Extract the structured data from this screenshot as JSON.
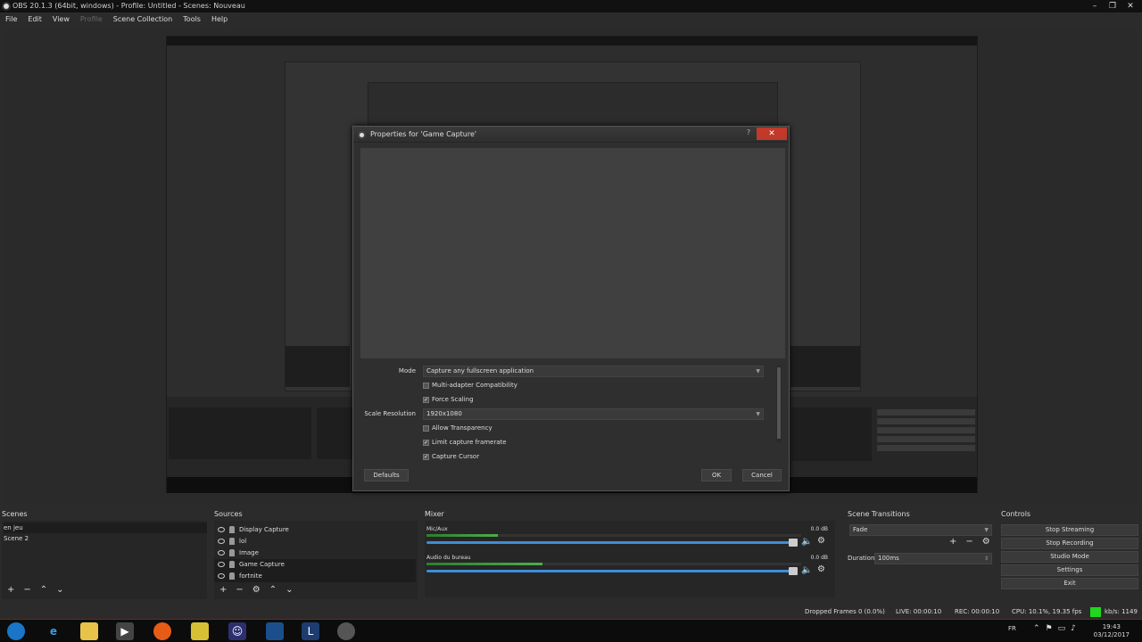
{
  "window": {
    "title": "OBS 20.1.3 (64bit, windows) - Profile: Untitled - Scenes: Nouveau",
    "controls": [
      "–",
      "❐",
      "✕"
    ]
  },
  "menu": [
    "File",
    "Edit",
    "View",
    "Profile",
    "Scene Collection",
    "Tools",
    "Help"
  ],
  "dialog": {
    "title": "Properties for 'Game Capture'",
    "help": "?",
    "close": "✕",
    "mode_label": "Mode",
    "mode_value": "Capture any fullscreen application",
    "multi_adapter": "Multi-adapter Compatibility",
    "force_scaling": "Force Scaling",
    "scale_label": "Scale Resolution",
    "scale_value": "1920x1080",
    "allow_transparency": "Allow Transparency",
    "limit_framerate": "Limit capture framerate",
    "capture_cursor": "Capture Cursor",
    "check_mark": "✓",
    "defaults": "Defaults",
    "ok": "OK",
    "cancel": "Cancel"
  },
  "scenes": {
    "title": "Scenes",
    "items": [
      "en jeu",
      "Scene 2"
    ]
  },
  "sources": {
    "title": "Sources",
    "items": [
      "Display Capture",
      "lol",
      "Image",
      "Game Capture",
      "fortnite"
    ]
  },
  "mixer": {
    "title": "Mixer",
    "tracks": [
      {
        "name": "Mic/Aux",
        "db": "0.0 dB",
        "level": 0.19
      },
      {
        "name": "Audio du bureau",
        "db": "0.0 dB",
        "level": 0.31
      }
    ]
  },
  "transitions": {
    "title": "Scene Transitions",
    "type": "Fade",
    "duration_label": "Duration",
    "duration_value": "100ms"
  },
  "controls": {
    "title": "Controls",
    "buttons": [
      "Stop Streaming",
      "Stop Recording",
      "Studio Mode",
      "Settings",
      "Exit"
    ]
  },
  "status": {
    "dropped": "Dropped Frames 0 (0.0%)",
    "live": "LIVE: 00:00:10",
    "rec": "REC: 00:00:10",
    "cpu": "CPU: 10.1%, 19.35 fps",
    "kbs": "kb/s: 1149"
  },
  "taskbar": {
    "lang": "FR",
    "time": "19:43",
    "date": "03/12/2017"
  },
  "colors": {
    "accent": "#3d8dd6",
    "status_green": "#1ed71e",
    "close_red": "#c0392b"
  }
}
